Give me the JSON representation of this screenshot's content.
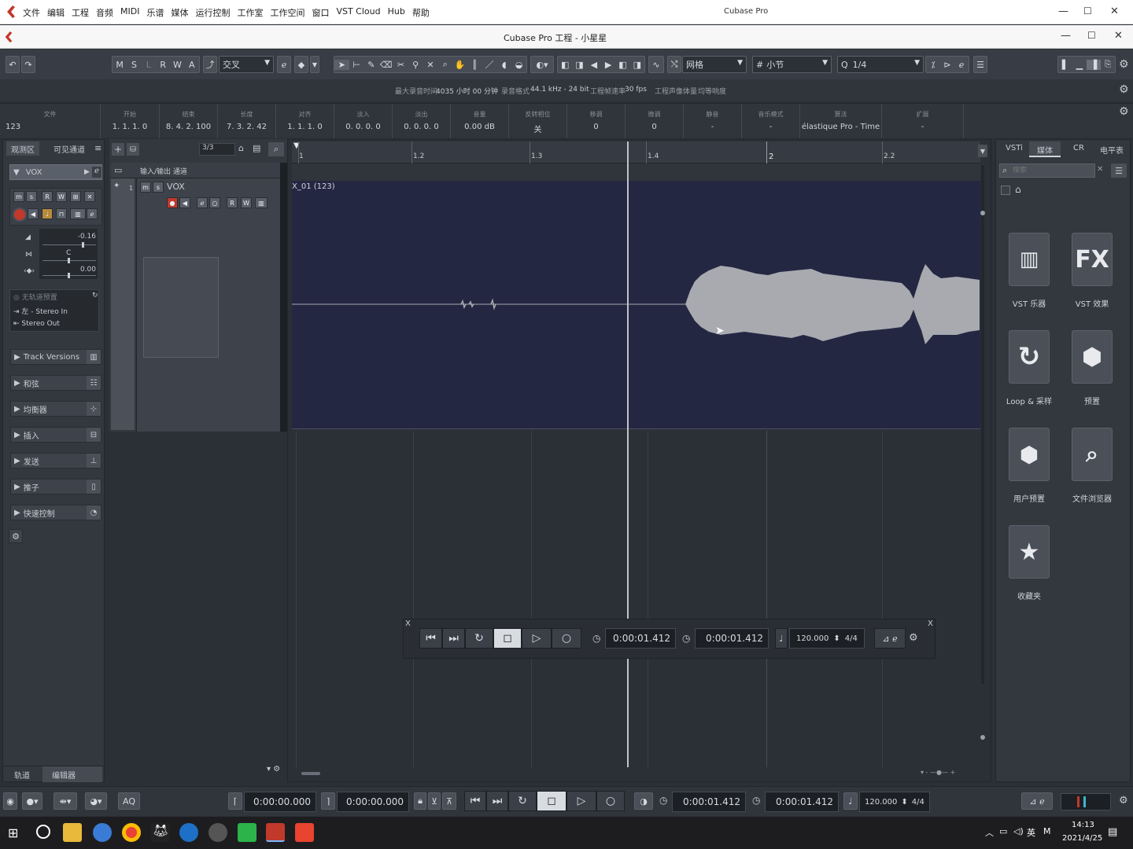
{
  "os_window": {
    "menu": [
      "文件",
      "编辑",
      "工程",
      "音频",
      "MIDI",
      "乐谱",
      "媒体",
      "运行控制",
      "工作室",
      "工作空间",
      "窗口",
      "VST Cloud",
      "Hub",
      "帮助"
    ],
    "title": "Cubase Pro"
  },
  "project_window": {
    "title": "Cubase Pro 工程 - 小星星"
  },
  "toolbar": {
    "state_buttons": [
      "M",
      "S",
      "L",
      "R",
      "W",
      "A"
    ],
    "mode_dropdown": "交叉",
    "grid_type": "网格",
    "grid_value": "小节",
    "quantize_value": "1/4"
  },
  "status_line": {
    "max_record_time_label": "最大录音时间",
    "max_record_time": "4035 小时 00 分钟",
    "record_format_label": "录音格式",
    "record_format": "44.1 kHz - 24 bit",
    "frame_rate_label": "工程帧速率",
    "frame_rate": "30 fps",
    "pan_law_label": "工程声像体量",
    "loudness_label": "均等响度"
  },
  "info_line": {
    "columns": [
      {
        "header": "文件",
        "value": "123"
      },
      {
        "header": "开始",
        "value": "1. 1. 1.   0"
      },
      {
        "header": "结束",
        "value": "8. 4. 2. 100"
      },
      {
        "header": "长度",
        "value": "7. 3. 2.  42"
      },
      {
        "header": "对齐",
        "value": "1. 1. 1.   0"
      },
      {
        "header": "淡入",
        "value": "0. 0. 0.   0"
      },
      {
        "header": "淡出",
        "value": "0. 0. 0.   0"
      },
      {
        "header": "音量",
        "value": "0.00        dB"
      },
      {
        "header": "反转相位",
        "value": "关"
      },
      {
        "header": "移调",
        "value": "0"
      },
      {
        "header": "微调",
        "value": "0"
      },
      {
        "header": "静音",
        "value": "-"
      },
      {
        "header": "音乐模式",
        "value": "-"
      },
      {
        "header": "算法",
        "value": "élastique Pro - Time"
      },
      {
        "header": "扩展",
        "value": "-"
      }
    ]
  },
  "inspector": {
    "tabs": [
      "观测区",
      "可见通道"
    ],
    "track_name": "VOX",
    "volume": "-0.16",
    "pan": "C",
    "delay": "0.00",
    "no_preset": "无轨道预置",
    "input_routing": "左 - Stereo In",
    "output_routing": "Stereo Out",
    "sections": [
      "Track Versions",
      "和弦",
      "均衡器",
      "插入",
      "发送",
      "推子",
      "快速控制"
    ],
    "bottom_tabs": [
      "轨道",
      "编辑器"
    ]
  },
  "track_list": {
    "counter": "3/3",
    "folder_label": "输入/输出 通道",
    "track_name": "VOX"
  },
  "arranger": {
    "ruler_labels": [
      "1",
      "1.2",
      "1.3",
      "1.4",
      "2",
      "2.2"
    ],
    "event_label": "X_01 (123)"
  },
  "floating_transport": {
    "primary_time": "0:00:01.412",
    "secondary_time": "0:00:01.412",
    "tempo": "120.000",
    "signature": "4/4"
  },
  "media_bay": {
    "tabs": [
      "VSTi",
      "媒体",
      "CR",
      "电平表"
    ],
    "search_placeholder": "搜索",
    "tiles": [
      {
        "label": "VST 乐器",
        "icon": "piano-keys-icon"
      },
      {
        "label": "VST 效果",
        "icon": "fx-icon"
      },
      {
        "label": "Loop & 采样",
        "icon": "loop-icon"
      },
      {
        "label": "预置",
        "icon": "preset-hexagon-icon"
      },
      {
        "label": "用户预置",
        "icon": "user-preset-icon"
      },
      {
        "label": "文件浏览器",
        "icon": "file-browser-icon"
      },
      {
        "label": "收藏夹",
        "icon": "star-icon"
      }
    ]
  },
  "bottom_transport": {
    "aq_label": "AQ",
    "left_locator": "0:00:00.000",
    "right_locator": "0:00:00.000",
    "primary_time": "0:00:01.412",
    "secondary_time": "0:00:01.412",
    "tempo": "120.000",
    "signature": "4/4"
  },
  "taskbar": {
    "ime": "英",
    "time": "14:13",
    "date": "2021/4/25"
  },
  "colors": {
    "accent_red": "#c0392b",
    "event_bg": "#232742",
    "waveform": "#a8aab0",
    "active_tab": "#454a53"
  }
}
